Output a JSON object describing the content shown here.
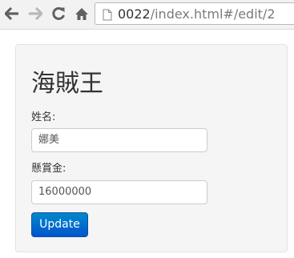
{
  "browser": {
    "url_base": "0022",
    "url_rest": "/index.html#/edit/2",
    "icons": {
      "back": "back-arrow-icon",
      "forward": "forward-arrow-icon",
      "reload": "reload-icon",
      "home": "home-icon",
      "page": "page-icon"
    }
  },
  "form": {
    "title": "海賊王",
    "name_label": "姓名:",
    "name_value": "娜美",
    "bounty_label": "懸賞金:",
    "bounty_value": "16000000",
    "submit_label": "Update"
  },
  "colors": {
    "button": "#0066cc",
    "panel": "#f5f5f5"
  }
}
